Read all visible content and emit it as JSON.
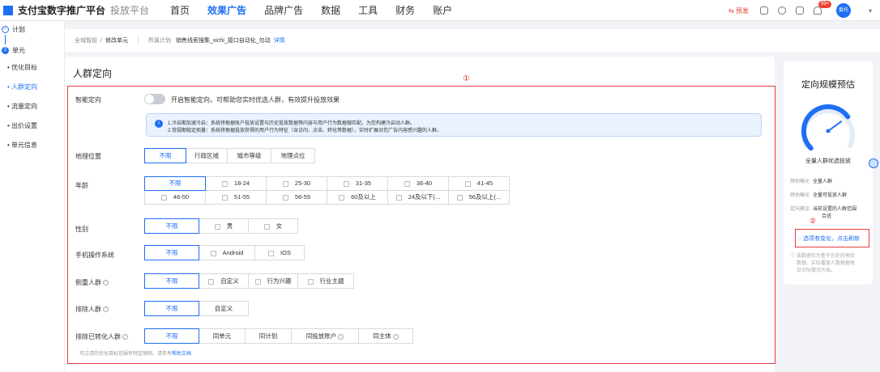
{
  "topbar": {
    "brand": "支付宝数字推广平台",
    "brand_sub": "投放平台",
    "nav": [
      "首页",
      "效果广告",
      "品牌广告",
      "数据",
      "工具",
      "财务",
      "账户"
    ],
    "warn": "⇆ 预发",
    "badge": "99+",
    "avatar": "委托"
  },
  "sidebar": {
    "step1": "计划",
    "step2": "单元",
    "step1_num": "✓",
    "step2_num": "2",
    "items": [
      "• 优化目标",
      "• 人群定向",
      "• 流量定向",
      "• 出价设置",
      "• 单元信息"
    ]
  },
  "breadcrumb": {
    "root": "全域智投",
    "sep": "/",
    "current": "修改单元",
    "plan_label": "所属计划",
    "plan_name": "销售线索搜集_xichi_接口自动化_勿动",
    "detail": "详情"
  },
  "main": {
    "title": "人群定向",
    "marker": "①",
    "smart": {
      "label": "智能定向",
      "text": "开启智能定向，可帮助您实时优选人群，有效提升投放效果"
    },
    "info": {
      "line1": "1.冷启期加速冷启：系统将根据账户投放设置与历史投放数据等内容与用户行为数据做匹配，为您构建冷启动人群。",
      "line2": "2.常规期稳定拓量：系统将根据投放获得的用户行为特征（含访问、点击、转化等数据），实时扩展对您广告内容感兴趣的人群。"
    },
    "geo": {
      "label": "地理位置",
      "options": [
        "不限",
        "行政区域",
        "城市等级",
        "地理点位"
      ]
    },
    "age": {
      "label": "年龄",
      "options": [
        "不限",
        "18-24",
        "25-30",
        "31-35",
        "36-40",
        "41-45",
        "46-50",
        "51-55",
        "56-59",
        "60及以上",
        "24及以下(...",
        "56及以上(..."
      ]
    },
    "gender": {
      "label": "性别",
      "options": [
        "不限",
        "男",
        "女"
      ]
    },
    "os": {
      "label": "手机操作系统",
      "options": [
        "不限",
        "Android",
        "IOS"
      ]
    },
    "focus": {
      "label": "侧重人群",
      "options": [
        "不限",
        "自定义",
        "行为兴趣",
        "行业主题"
      ]
    },
    "exclude": {
      "label": "排除人群",
      "options": [
        "不限",
        "自定义"
      ]
    },
    "exclude_converted": {
      "label": "排除已转化人群",
      "options": [
        "不限",
        "同单元",
        "同计划",
        "同投放账户",
        "同主体"
      ],
      "hint": "可过滤的优化目标范围有特定限制，请参考",
      "hint_link": "帮助文档"
    }
  },
  "estimate": {
    "title": "定向规模预估",
    "gauge_level": 0.7,
    "gauge_label": "全量人群优选投放",
    "rows": [
      {
        "k": "预估曝光",
        "v": "全量人群"
      },
      {
        "k": "预估曝光",
        "v": "全量可投放人群"
      },
      {
        "k": "定向建议",
        "v": "当前设置的人群范围"
      }
    ],
    "row3_cont": "合适",
    "marker": "②",
    "refresh": "◌ 选项有变化，点击刷新",
    "note": [
      "ⓘ 该数据仅为基于历史的预估",
      "数据，实际覆盖人数根据每",
      "日实际情况为准。"
    ]
  },
  "colors": {
    "accent": "#1e6ff5",
    "annotation": "#e43d3d"
  }
}
